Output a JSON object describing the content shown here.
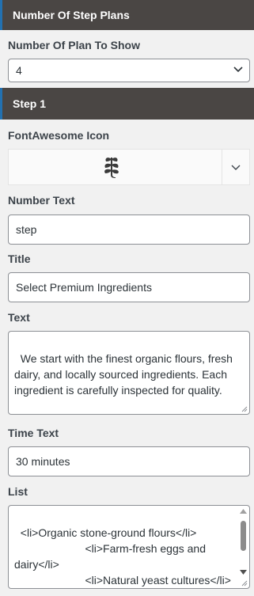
{
  "panel": {
    "section_title": "Number Of Step Plans",
    "plan_count_label": "Number Of Plan To Show",
    "plan_count_value": "4"
  },
  "step": {
    "title": "Step 1",
    "icon_label": "FontAwesome Icon",
    "icon_name": "leaf-icon",
    "number_text_label": "Number Text",
    "number_text_value": "step",
    "title_label": "Title",
    "title_value": "Select Premium Ingredients",
    "text_label": "Text",
    "text_value": "We start with the finest organic flours, fresh dairy, and locally sourced ingredients. Each ingredient is carefully inspected for quality.",
    "time_label": "Time Text",
    "time_value": "30 minutes",
    "list_label": "List",
    "list_value": "<li>Organic stone-ground flours</li>\n                       <li>Farm-fresh eggs and dairy</li>\n                       <li>Natural yeast cultures</li>"
  },
  "colors": {
    "header_bg": "#4a4644",
    "accent": "#2271b1"
  }
}
